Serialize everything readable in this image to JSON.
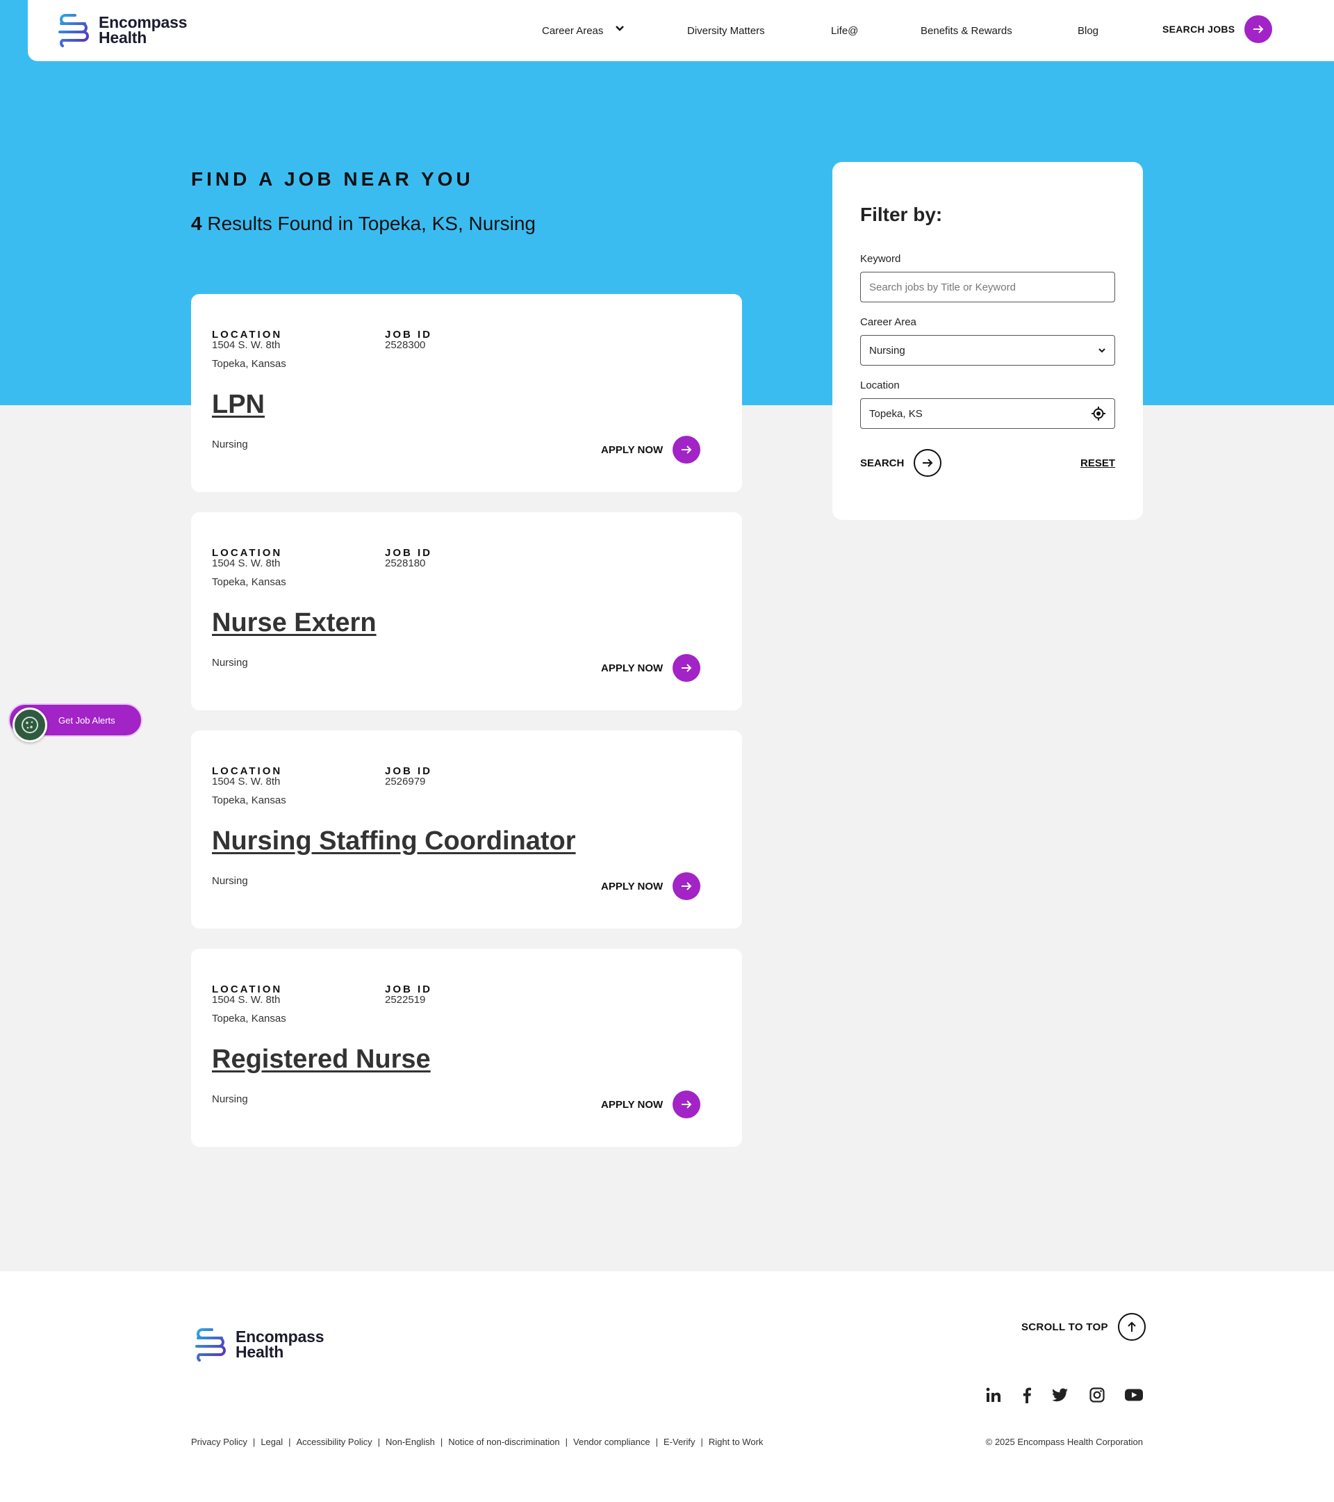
{
  "brand": {
    "name_line1": "Encompass",
    "name_line2": "Health",
    "colors": {
      "hero": "#3bbcf1",
      "accent": "#a223c6"
    }
  },
  "nav": {
    "items": [
      "Career Areas",
      "Diversity Matters",
      "Life@",
      "Benefits & Rewards",
      "Blog"
    ],
    "search_jobs": "SEARCH JOBS"
  },
  "hero": {
    "title": "FIND A JOB NEAR YOU",
    "results_count": "4",
    "results_text": " Results Found in Topeka, KS, Nursing"
  },
  "jobs": {
    "location_label": "LOCATION",
    "jobid_label": "JOB ID",
    "apply_label": "APPLY NOW",
    "items": [
      {
        "address": "1504 S. W. 8th",
        "city": "Topeka, Kansas",
        "job_id": "2528300",
        "title": "LPN",
        "category": "Nursing"
      },
      {
        "address": "1504 S. W. 8th",
        "city": "Topeka, Kansas",
        "job_id": "2528180",
        "title": "Nurse Extern",
        "category": "Nursing"
      },
      {
        "address": "1504 S. W. 8th",
        "city": "Topeka, Kansas",
        "job_id": "2526979",
        "title": "Nursing Staffing Coordinator",
        "category": "Nursing"
      },
      {
        "address": "1504 S. W. 8th",
        "city": "Topeka, Kansas",
        "job_id": "2522519",
        "title": "Registered Nurse",
        "category": "Nursing"
      }
    ]
  },
  "filter": {
    "heading": "Filter by:",
    "keyword_label": "Keyword",
    "keyword_placeholder": "Search jobs by Title or Keyword",
    "career_label": "Career Area",
    "career_value": "Nursing",
    "location_label": "Location",
    "location_value": "Topeka, KS",
    "search_label": "SEARCH",
    "reset_label": "RESET"
  },
  "alerts": {
    "label": "Get Job Alerts"
  },
  "footer": {
    "scroll_top": "SCROLL TO TOP",
    "legal_links": [
      "Privacy Policy",
      "Legal",
      "Accessibility Policy",
      "Non-English",
      "Notice of non-discrimination",
      "Vendor compliance",
      "E-Verify",
      "Right to Work"
    ],
    "copyright": "© 2025 Encompass Health Corporation",
    "social": [
      "linkedin-icon",
      "facebook-icon",
      "twitter-icon",
      "instagram-icon",
      "youtube-icon"
    ]
  }
}
